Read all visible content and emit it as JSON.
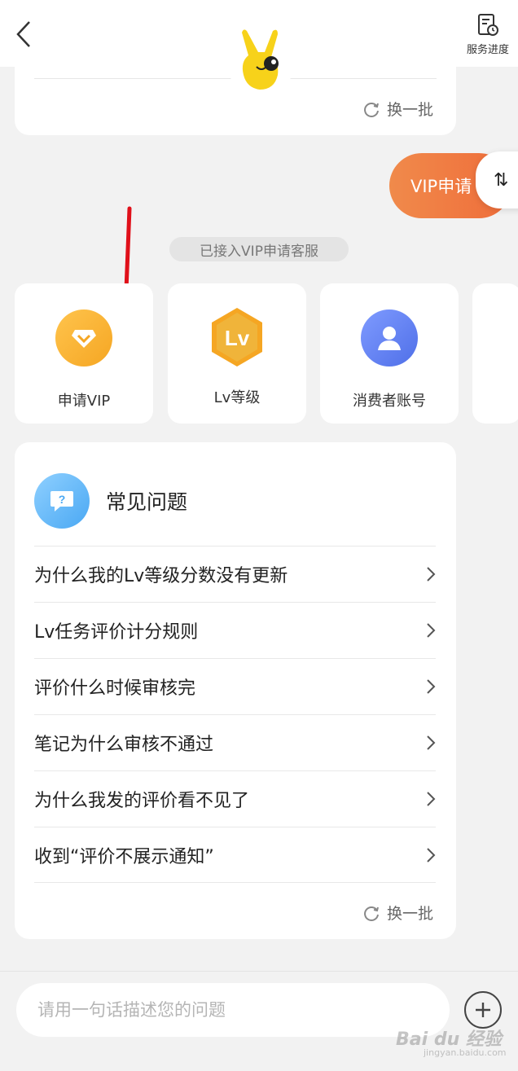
{
  "header": {
    "service_progress_label": "服务进度"
  },
  "top_card": {
    "refresh_label": "换一批"
  },
  "chat": {
    "vip_bubble_text": "VIP申请",
    "swap_icon_glyph": "⇅",
    "status_text": "已接入VIP申请客服"
  },
  "services": [
    {
      "label": "申请VIP",
      "icon": "diamond-icon",
      "color": "#f5a623"
    },
    {
      "label": "Lv等级",
      "icon": "lv-badge-icon",
      "color": "#f5a623"
    },
    {
      "label": "消费者账号",
      "icon": "user-icon",
      "color": "#5b7cf0"
    },
    {
      "label": "",
      "icon": "partial-tile"
    }
  ],
  "faq": {
    "title": "常见问题",
    "items": [
      "为什么我的Lv等级分数没有更新",
      "Lv任务评价计分规则",
      "评价什么时候审核完",
      "笔记为什么审核不通过",
      "为什么我发的评价看不见了",
      "收到“评价不展示通知”"
    ],
    "refresh_label": "换一批"
  },
  "input": {
    "placeholder": "请用一句话描述您的问题"
  },
  "watermark": {
    "text": "Bai du 经验",
    "sub": "jingyan.baidu.com"
  },
  "colors": {
    "accent_orange": "#ef6d3a",
    "red_arrow": "#e0101a",
    "faq_icon_blue": "#4aa8f3"
  }
}
